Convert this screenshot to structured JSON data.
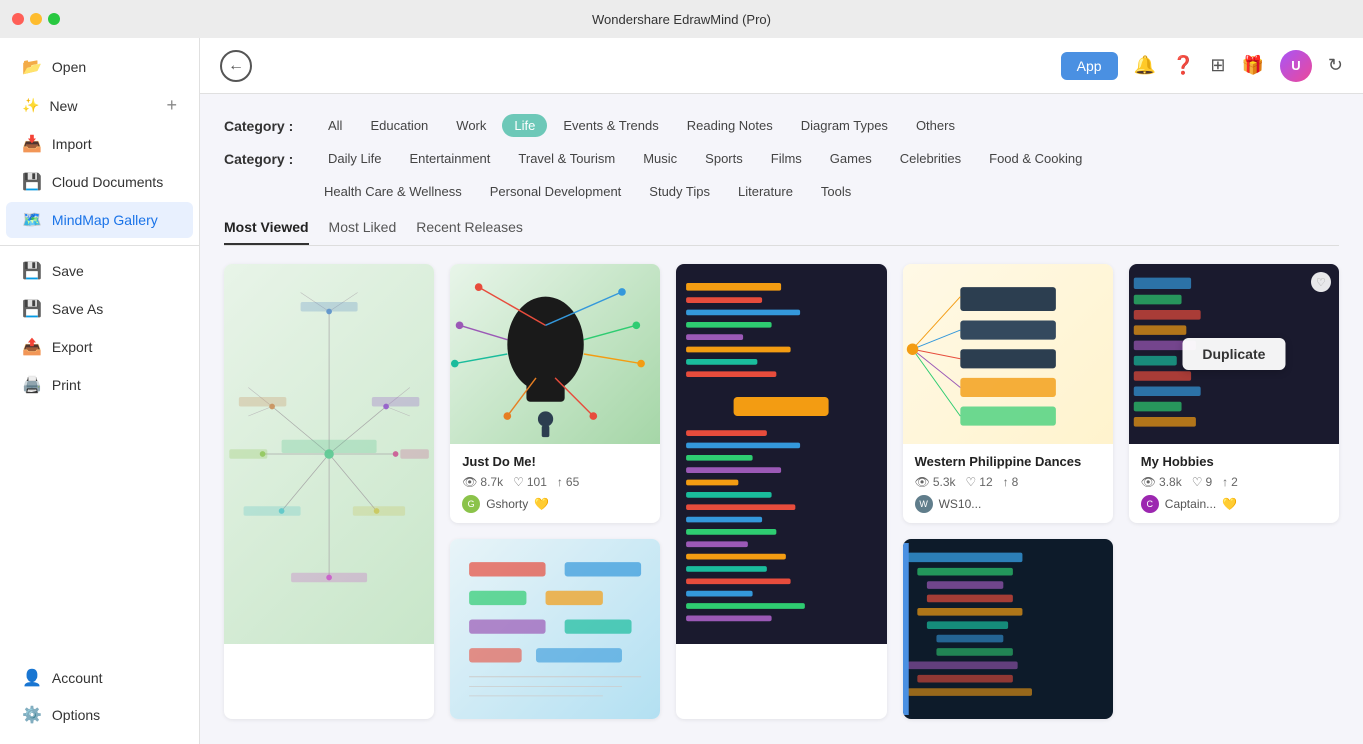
{
  "titlebar": {
    "title": "Wondershare EdrawMind (Pro)"
  },
  "sidebar": {
    "items": [
      {
        "id": "open",
        "label": "Open",
        "icon": "📂"
      },
      {
        "id": "new",
        "label": "New",
        "icon": "✨"
      },
      {
        "id": "import",
        "label": "Import",
        "icon": "📥"
      },
      {
        "id": "cloud",
        "label": "Cloud Documents",
        "icon": "💾"
      },
      {
        "id": "gallery",
        "label": "MindMap Gallery",
        "icon": "🗺️",
        "active": true
      },
      {
        "id": "save",
        "label": "Save",
        "icon": "💾"
      },
      {
        "id": "saveas",
        "label": "Save As",
        "icon": "💾"
      },
      {
        "id": "export",
        "label": "Export",
        "icon": "📤"
      },
      {
        "id": "print",
        "label": "Print",
        "icon": "🖨️"
      }
    ],
    "bottom": [
      {
        "id": "account",
        "label": "Account",
        "icon": "👤"
      },
      {
        "id": "options",
        "label": "Options",
        "icon": "⚙️"
      }
    ]
  },
  "header": {
    "back_label": "←",
    "app_label": "App",
    "icons": [
      "🔔",
      "?",
      "⊞",
      "🎁"
    ]
  },
  "categories": {
    "row1_label": "Category :",
    "row1": [
      {
        "id": "all",
        "label": "All",
        "active": false
      },
      {
        "id": "education",
        "label": "Education",
        "active": false
      },
      {
        "id": "work",
        "label": "Work",
        "active": false
      },
      {
        "id": "life",
        "label": "Life",
        "active": true
      },
      {
        "id": "events",
        "label": "Events & Trends",
        "active": false
      },
      {
        "id": "reading",
        "label": "Reading Notes",
        "active": false
      },
      {
        "id": "diagram",
        "label": "Diagram Types",
        "active": false
      },
      {
        "id": "others",
        "label": "Others",
        "active": false
      }
    ],
    "row2_label": "Category :",
    "row2": [
      {
        "id": "daily",
        "label": "Daily Life",
        "active": false
      },
      {
        "id": "entertainment",
        "label": "Entertainment",
        "active": false
      },
      {
        "id": "travel",
        "label": "Travel & Tourism",
        "active": false
      },
      {
        "id": "music",
        "label": "Music",
        "active": false
      },
      {
        "id": "sports",
        "label": "Sports",
        "active": false
      },
      {
        "id": "films",
        "label": "Films",
        "active": false
      },
      {
        "id": "games",
        "label": "Games",
        "active": false
      },
      {
        "id": "celebrities",
        "label": "Celebrities",
        "active": false
      },
      {
        "id": "food",
        "label": "Food & Cooking",
        "active": false
      }
    ],
    "row3": [
      {
        "id": "health",
        "label": "Health Care & Wellness",
        "active": false
      },
      {
        "id": "personal",
        "label": "Personal Development",
        "active": false
      },
      {
        "id": "study",
        "label": "Study Tips",
        "active": false
      },
      {
        "id": "literature",
        "label": "Literature",
        "active": false
      },
      {
        "id": "tools",
        "label": "Tools",
        "active": false
      }
    ]
  },
  "sort_tabs": [
    {
      "id": "most_viewed",
      "label": "Most Viewed",
      "active": true
    },
    {
      "id": "most_liked",
      "label": "Most Liked",
      "active": false
    },
    {
      "id": "recent",
      "label": "Recent Releases",
      "active": false
    }
  ],
  "cards": [
    {
      "id": "card1",
      "title": "",
      "views": "",
      "likes": "",
      "shares": "",
      "author": "",
      "author_badge": "",
      "tall": true,
      "thumb_class": "thumb-1"
    },
    {
      "id": "card2",
      "title": "Just Do Me!",
      "views": "8.7k",
      "likes": "101",
      "shares": "65",
      "author": "Gshorty",
      "author_badge": "gold",
      "tall": false,
      "thumb_class": "thumb-2"
    },
    {
      "id": "card3",
      "title": "",
      "views": "",
      "likes": "",
      "shares": "",
      "author": "",
      "author_badge": "",
      "tall": true,
      "thumb_class": "thumb-3"
    },
    {
      "id": "card4",
      "title": "Western Philippine Dances",
      "views": "5.3k",
      "likes": "12",
      "shares": "8",
      "author": "WS10...",
      "author_badge": "",
      "tall": false,
      "thumb_class": "thumb-4"
    },
    {
      "id": "card5",
      "title": "My Hobbies",
      "views": "3.8k",
      "likes": "9",
      "shares": "2",
      "author": "Captain...",
      "author_badge": "gold",
      "tall": false,
      "duplicate": true,
      "thumb_class": "thumb-5"
    },
    {
      "id": "card6",
      "title": "",
      "views": "",
      "likes": "",
      "shares": "",
      "author": "",
      "tall": false,
      "thumb_class": "thumb-6"
    },
    {
      "id": "card7",
      "title": "",
      "views": "",
      "likes": "",
      "shares": "",
      "author": "",
      "tall": false,
      "thumb_class": "thumb-7"
    }
  ],
  "duplicate_label": "Duplicate"
}
